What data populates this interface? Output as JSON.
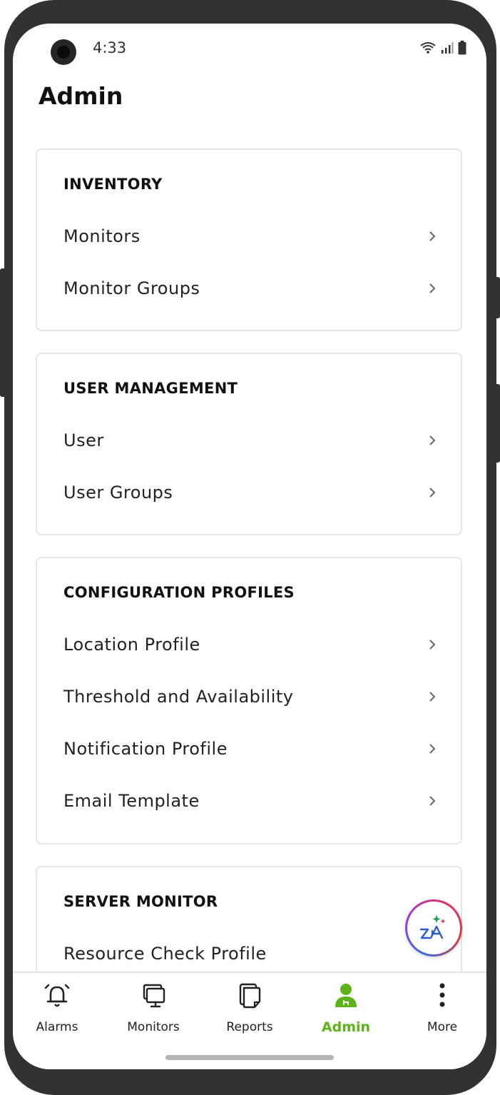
{
  "status_bar": {
    "time": "4:33"
  },
  "page_title": "Admin",
  "sections": [
    {
      "title": "INVENTORY",
      "items": [
        "Monitors",
        "Monitor Groups"
      ]
    },
    {
      "title": "USER MANAGEMENT",
      "items": [
        "User",
        "User Groups"
      ]
    },
    {
      "title": "CONFIGURATION PROFILES",
      "items": [
        "Location Profile",
        "Threshold and Availability",
        "Notification Profile",
        "Email Template"
      ]
    },
    {
      "title": "SERVER MONITOR",
      "items": [
        "Resource Check Profile"
      ]
    }
  ],
  "fab": {
    "icon": "zia-assistant-icon"
  },
  "bottom_nav": [
    {
      "label": "Alarms",
      "icon": "alarm-bell-icon",
      "active": false
    },
    {
      "label": "Monitors",
      "icon": "monitor-icon",
      "active": false
    },
    {
      "label": "Reports",
      "icon": "reports-icon",
      "active": false
    },
    {
      "label": "Admin",
      "icon": "admin-user-icon",
      "active": true
    },
    {
      "label": "More",
      "icon": "more-vertical-icon",
      "active": false
    }
  ],
  "colors": {
    "accent": "#5bb318",
    "card_border": "#e6e6e6",
    "text": "#222222"
  }
}
